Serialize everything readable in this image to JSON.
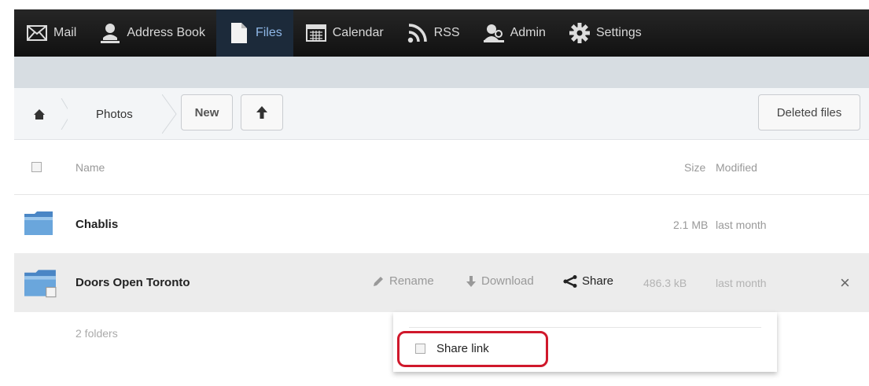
{
  "nav": {
    "items": [
      {
        "label": "Mail",
        "icon": "mail-icon"
      },
      {
        "label": "Address Book",
        "icon": "person-icon"
      },
      {
        "label": "Files",
        "icon": "file-icon",
        "active": true
      },
      {
        "label": "Calendar",
        "icon": "calendar-icon"
      },
      {
        "label": "RSS",
        "icon": "rss-icon"
      },
      {
        "label": "Admin",
        "icon": "admin-icon"
      },
      {
        "label": "Settings",
        "icon": "gear-icon"
      }
    ]
  },
  "breadcrumb": {
    "home_icon": "home-icon",
    "current": "Photos"
  },
  "toolbar": {
    "new_label": "New",
    "upload_icon": "up-arrow-icon",
    "deleted_files_label": "Deleted files"
  },
  "list": {
    "columns": {
      "name": "Name",
      "size": "Size",
      "modified": "Modified"
    },
    "rows": [
      {
        "name": "Chablis",
        "size": "2.1 MB",
        "modified": "last month"
      },
      {
        "name": "Doors Open Toronto",
        "size": "486.3 kB",
        "modified": "last month"
      }
    ],
    "actions": {
      "rename": "Rename",
      "download": "Download",
      "share": "Share"
    },
    "summary": "2 folders"
  },
  "share_dropdown": {
    "share_link_label": "Share link"
  },
  "colors": {
    "nav_bg": "#1a1a1a",
    "active_tab": "#8fb8e8",
    "highlight": "#d0182b"
  }
}
